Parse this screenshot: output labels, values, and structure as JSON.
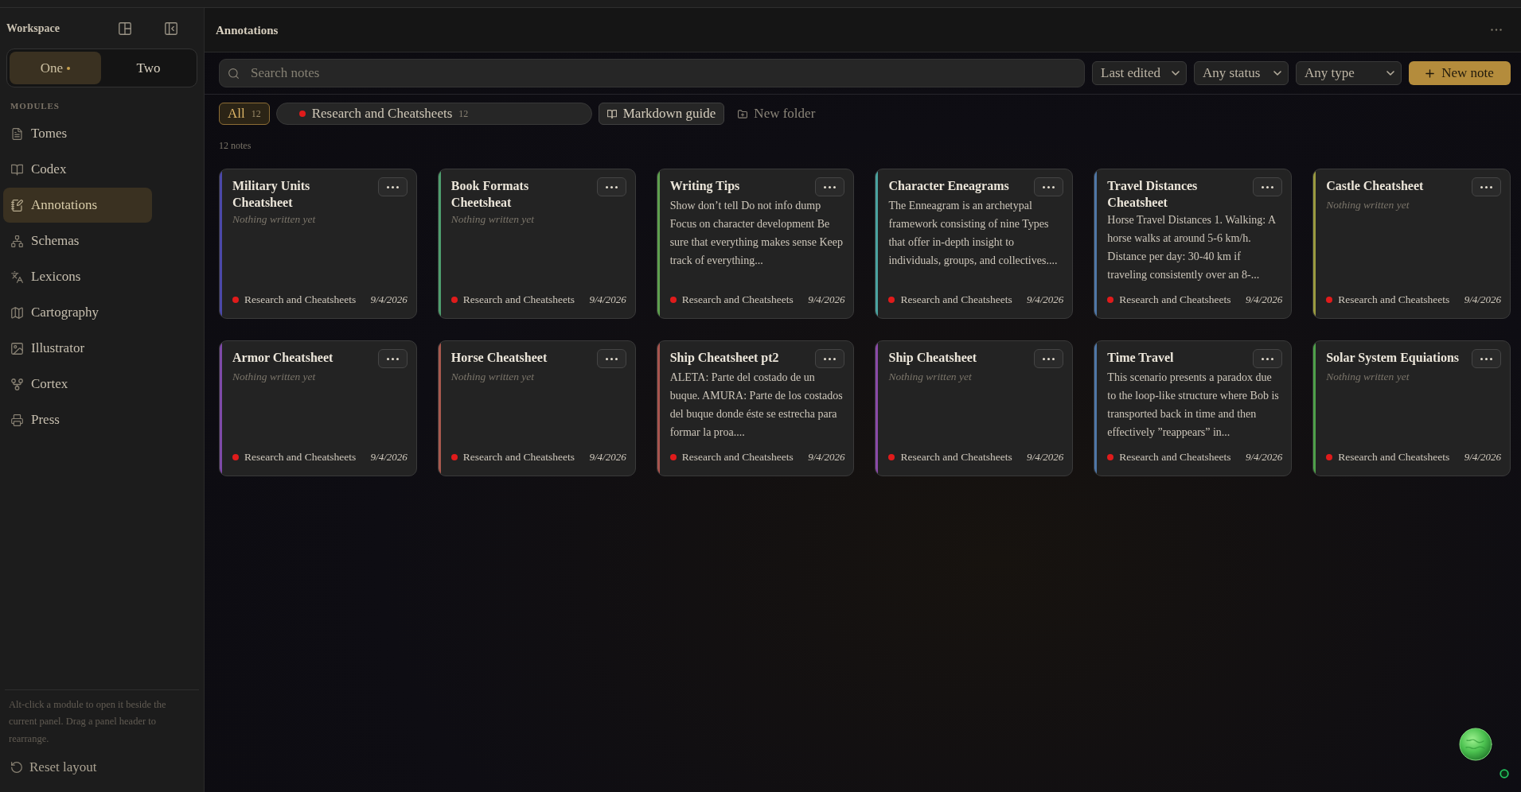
{
  "sidebar": {
    "title": "Workspace",
    "workspaces": [
      {
        "label": "One",
        "selected": true,
        "indicator": true
      },
      {
        "label": "Two",
        "selected": false,
        "indicator": false
      }
    ],
    "section_label": "MODULES",
    "modules": [
      {
        "label": "Tomes",
        "selected": false
      },
      {
        "label": "Codex",
        "selected": false
      },
      {
        "label": "Annotations",
        "selected": true
      },
      {
        "label": "Schemas",
        "selected": false
      },
      {
        "label": "Lexicons",
        "selected": false
      },
      {
        "label": "Cartography",
        "selected": false
      },
      {
        "label": "Illustrator",
        "selected": false
      },
      {
        "label": "Cortex",
        "selected": false
      },
      {
        "label": "Press",
        "selected": false
      }
    ],
    "help_text": "Alt-click a module to open it beside the current panel. Drag a panel header to rearrange.",
    "reset_button": "Reset layout"
  },
  "panel": {
    "title": "Annotations"
  },
  "toolbar": {
    "search": {
      "placeholder": "Search notes"
    },
    "sort": "Last edited",
    "status_filter": "Any status",
    "type_filter": "Any type",
    "new_note_button": "New note"
  },
  "folders": {
    "chips": [
      {
        "kind": "all",
        "label": "All",
        "count": "12",
        "selected": true
      },
      {
        "kind": "folder",
        "label": "Research and Cheatsheets",
        "count": "12",
        "selected": false,
        "color": "#e01b1b"
      }
    ],
    "guide_button": "Markdown guide",
    "new_folder_button": "New folder"
  },
  "note_count": "12 notes",
  "notes": [
    {
      "title": "Military Units Cheatsheet",
      "preview": "Nothing written yet",
      "empty": true,
      "folder": {
        "name": "Research and Cheatsheets",
        "color": "#e01b1b"
      },
      "date": "9/4/2026",
      "color": "#4b48a8"
    },
    {
      "title": "Book Formats Cheetsheat",
      "preview": "Nothing written yet",
      "empty": true,
      "folder": {
        "name": "Research and Cheatsheets",
        "color": "#e01b1b"
      },
      "date": "9/4/2026",
      "color": "#4e9e6e"
    },
    {
      "title": "Writing Tips",
      "preview": "Show don’t tell Do not info dump Focus on character development Be sure that everything makes sense Keep track of everything...",
      "empty": false,
      "folder": {
        "name": "Research and Cheatsheets",
        "color": "#e01b1b"
      },
      "date": "9/4/2026",
      "color": "#5ea04e"
    },
    {
      "title": "Character Eneagrams",
      "preview": "The Enneagram is an archetypal framework consisting of nine Types that offer in-depth insight to individuals, groups, and collectives....",
      "empty": false,
      "folder": {
        "name": "Research and Cheatsheets",
        "color": "#e01b1b"
      },
      "date": "9/4/2026",
      "color": "#4aa3a0"
    },
    {
      "title": "Travel Distances Cheatsheet",
      "preview": "Horse Travel Distances 1. Walking: A horse walks at around 5-6 km/h. Distance per day: 30-40 km if traveling consistently over an 8-...",
      "empty": false,
      "folder": {
        "name": "Research and Cheatsheets",
        "color": "#e01b1b"
      },
      "date": "9/4/2026",
      "color": "#4f77a8"
    },
    {
      "title": "Castle Cheatsheet",
      "preview": "Nothing written yet",
      "empty": true,
      "folder": {
        "name": "Research and Cheatsheets",
        "color": "#e01b1b"
      },
      "date": "9/4/2026",
      "color": "#9a9a40"
    },
    {
      "title": "Armor Cheatsheet",
      "preview": "Nothing written yet",
      "empty": true,
      "folder": {
        "name": "Research and Cheatsheets",
        "color": "#e01b1b"
      },
      "date": "9/4/2026",
      "color": "#7e4aa8"
    },
    {
      "title": "Horse Cheatsheet",
      "preview": "Nothing written yet",
      "empty": true,
      "folder": {
        "name": "Research and Cheatsheets",
        "color": "#e01b1b"
      },
      "date": "9/4/2026",
      "color": "#a8594e"
    },
    {
      "title": "Ship Cheatsheet pt2",
      "preview": "ALETA: Parte del costado de un buque. AMURA: Parte de los costados del buque donde éste se estrecha para formar la proa....",
      "empty": false,
      "folder": {
        "name": "Research and Cheatsheets",
        "color": "#e01b1b"
      },
      "date": "9/4/2026",
      "color": "#a8544e"
    },
    {
      "title": "Ship Cheatsheet",
      "preview": "Nothing written yet",
      "empty": true,
      "folder": {
        "name": "Research and Cheatsheets",
        "color": "#e01b1b"
      },
      "date": "9/4/2026",
      "color": "#8a4aa8"
    },
    {
      "title": "Time Travel",
      "preview": "This scenario presents a paradox due to the loop-like structure where Bob is transported back in time and then effectively ”reappears” in...",
      "empty": false,
      "folder": {
        "name": "Research and Cheatsheets",
        "color": "#e01b1b"
      },
      "date": "9/4/2026",
      "color": "#4f77a8"
    },
    {
      "title": "Solar System Equiations",
      "preview": "Nothing written yet",
      "empty": true,
      "folder": {
        "name": "Research and Cheatsheets",
        "color": "#e01b1b"
      },
      "date": "9/4/2026",
      "color": "#4ea04a"
    }
  ]
}
